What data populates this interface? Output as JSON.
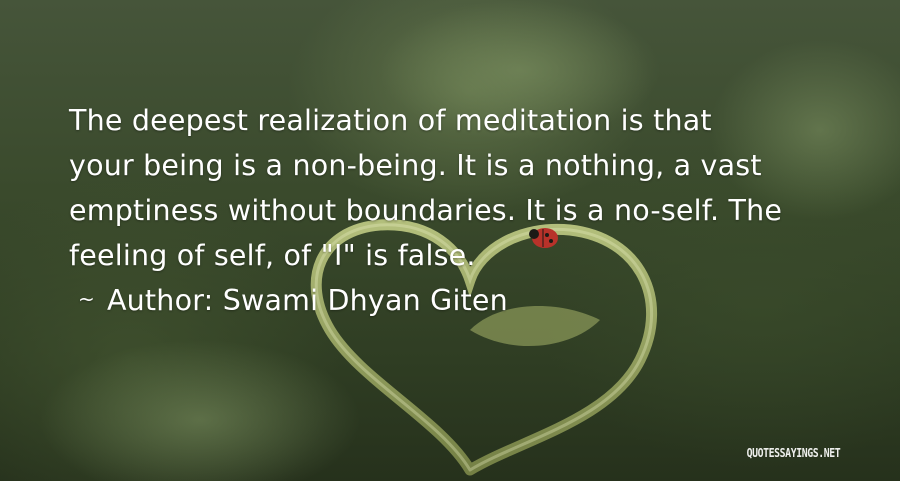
{
  "quote": {
    "lines": [
      "The deepest realization of meditation is that",
      "your being is a non-being. It is a nothing, a vast",
      "emptiness without boundaries. It is a no-self. The",
      "feeling of self, of \"I\" is false."
    ],
    "author_prefix": "~",
    "author_label": "Author:",
    "author_name": "Swami Dhyan Giten"
  },
  "watermark": {
    "text": "QUOTESSAYINGS.NET"
  },
  "colors": {
    "text": "#ffffff",
    "background": "#3a4a2c",
    "ladybug": "#b8322a"
  }
}
